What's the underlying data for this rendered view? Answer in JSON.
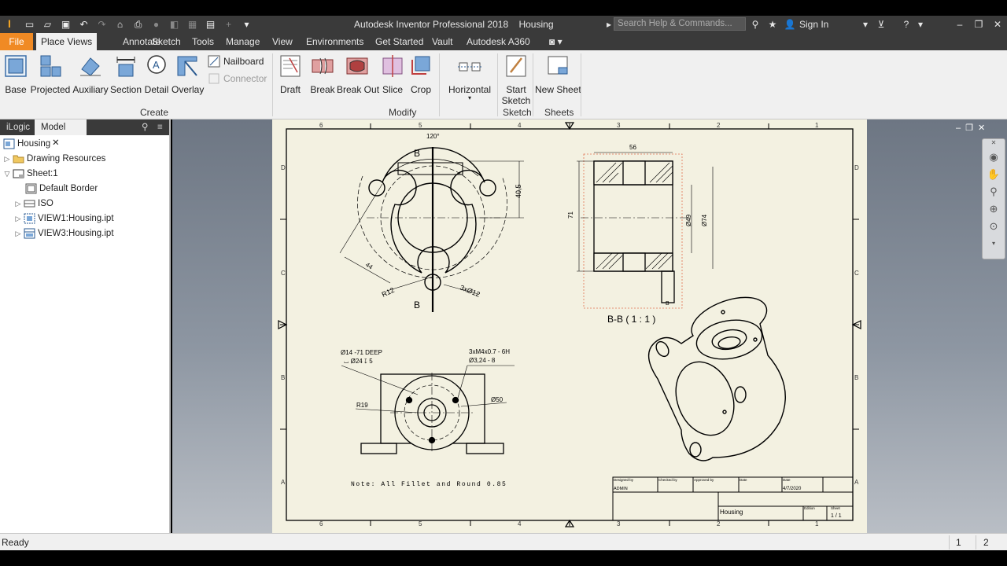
{
  "titlebar": {
    "title": "Autodesk Inventor Professional 2018    Housing",
    "search_placeholder": "Search Help & Commands...",
    "sign_in": "Sign In"
  },
  "tabs": [
    "File",
    "Place Views",
    "Annotate",
    "Sketch",
    "Tools",
    "Manage",
    "View",
    "Environments",
    "Get Started",
    "Vault",
    "Autodesk A360"
  ],
  "ribbon": {
    "create": {
      "label": "Create",
      "buttons": [
        "Base",
        "Projected",
        "Auxiliary",
        "Section",
        "Detail",
        "Overlay"
      ],
      "small": [
        "Nailboard",
        "Connector"
      ]
    },
    "modify": {
      "label": "Modify",
      "buttons": [
        "Draft",
        "Break",
        "Break Out",
        "Slice",
        "Crop",
        "Horizontal"
      ]
    },
    "sketch": {
      "label": "Sketch",
      "button_line1": "Start",
      "button_line2": "Sketch"
    },
    "sheets": {
      "label": "Sheets",
      "button": "New Sheet"
    }
  },
  "browser": {
    "tabs": [
      "iLogic",
      "Model"
    ],
    "tree": [
      "Housing",
      "Drawing Resources",
      "Sheet:1",
      "Default Border",
      "ISO",
      "VIEW1:Housing.ipt",
      "VIEW3:Housing.ipt"
    ]
  },
  "drawing": {
    "zone_numbers": [
      "6",
      "5",
      "4",
      "3",
      "2",
      "1"
    ],
    "zone_letters": [
      "D",
      "C",
      "B",
      "A"
    ],
    "dims_front": {
      "angle": "120°",
      "height": "40,5",
      "radius": "R12",
      "holes": "3xØ12",
      "diag": "44",
      "section": "B"
    },
    "dims_section": {
      "width": "56",
      "height": "71",
      "d1": "Ø49",
      "d2": "Ø74",
      "label": "B-B ( 1 : 1 )",
      "tag": "B"
    },
    "dims_bottom": {
      "hole1": "Ø14 -71 DEEP",
      "hole2": "⌴ Ø24 ↧ 5",
      "thread1": "3xM4x0.7 - 6H",
      "thread2": "Ø3,24 - 8",
      "r": "R19",
      "d": "Ø50"
    },
    "note": "Note: All Fillet and Round 0.85",
    "title_block": {
      "designed_by": "Designed by",
      "checked_by": "Checked by",
      "approved_by": "Approved by",
      "date": "Date",
      "designer": "ADMIN",
      "date_value": "4/7/2020",
      "title": "Housing",
      "edition": "Edition",
      "sheet": "Sheet",
      "sheet_value": "1 / 1"
    }
  },
  "status": {
    "text": "Ready",
    "page1": "1",
    "page2": "2"
  }
}
